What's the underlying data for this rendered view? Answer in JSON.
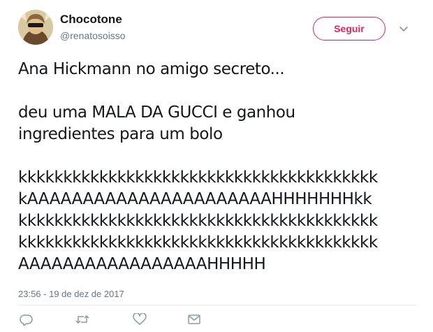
{
  "user": {
    "display_name": "Chocotone",
    "handle": "@renatosoisso"
  },
  "follow_button": {
    "label": "Seguir",
    "color": "#e0245e"
  },
  "tweet": {
    "lines": [
      "Ana Hickmann no amigo secreto...",
      "deu uma MALA DA GUCCI e ganhou",
      "ingredientes para um bolo",
      "kkkkkkkkkkkkkkkkkkkkkkkkkkkkkkkkkkkkkkkk",
      "kAAAAAAAAAAAAAAAAAAAAAAHHHHHHHkk",
      "kkkkkkkkkkkkkkkkkkkkkkkkkkkkkkkkkkkkkkkk",
      "kkkkkkkkkkkkkkkkkkkkkkkkkkkkkkkkkkkkkkkk",
      "AAAAAAAAAAAAAAAAAHHHHH"
    ],
    "timestamp": "23:56 - 19 de dez de 2017"
  },
  "actions": [
    {
      "icon": "reply-icon"
    },
    {
      "icon": "retweet-icon"
    },
    {
      "icon": "like-icon"
    },
    {
      "icon": "message-icon"
    }
  ],
  "colors": {
    "text": "#14171a",
    "secondary": "#657786",
    "accent": "#e0245e",
    "divider": "#e6ecf0"
  }
}
